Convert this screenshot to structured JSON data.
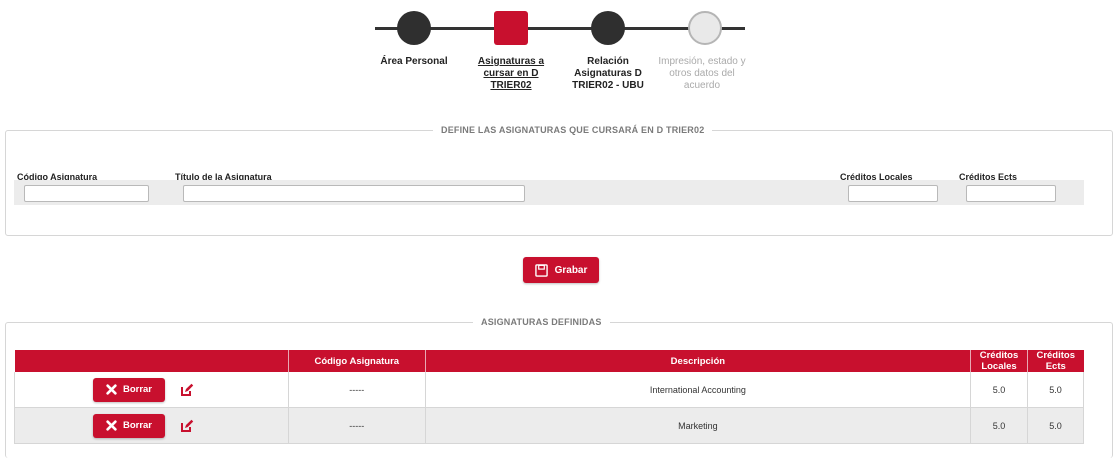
{
  "stepper": {
    "steps": [
      {
        "label": "Área Personal",
        "state": "done"
      },
      {
        "label": "Asignaturas a cursar en D TRIER02",
        "state": "current"
      },
      {
        "label": "Relación Asignaturas D TRIER02 - UBU",
        "state": "done"
      },
      {
        "label": "Impresión, estado y otros datos del acuerdo",
        "state": "pending"
      }
    ]
  },
  "define_section": {
    "legend": "DEFINE LAS ASIGNATURAS QUE CURSARÁ EN D TRIER02",
    "labels": {
      "code": "Código Asignatura",
      "title": "Título de la Asignatura",
      "local_credits": "Créditos Locales",
      "ects_credits": "Créditos Ects"
    },
    "values": {
      "code": "",
      "title": "",
      "local_credits": "",
      "ects_credits": ""
    }
  },
  "save_button": {
    "label": "Grabar",
    "icon": "floppy-disk-icon"
  },
  "defined_section": {
    "legend": "ASIGNATURAS DEFINIDAS",
    "columns": [
      "",
      "Código Asignatura",
      "Descripción",
      "Créditos Locales",
      "Créditos Ects"
    ],
    "rows": [
      {
        "delete_label": "Borrar",
        "code": "-----",
        "description": "International Accounting",
        "local_credits": "5.0",
        "ects_credits": "5.0"
      },
      {
        "delete_label": "Borrar",
        "code": "-----",
        "description": "Marketing",
        "local_credits": "5.0",
        "ects_credits": "5.0"
      }
    ]
  },
  "colors": {
    "accent": "#c8102e",
    "dark_node": "#2f2f2f",
    "pending_node": "#e9e9e9",
    "row_alt": "#ececec"
  }
}
